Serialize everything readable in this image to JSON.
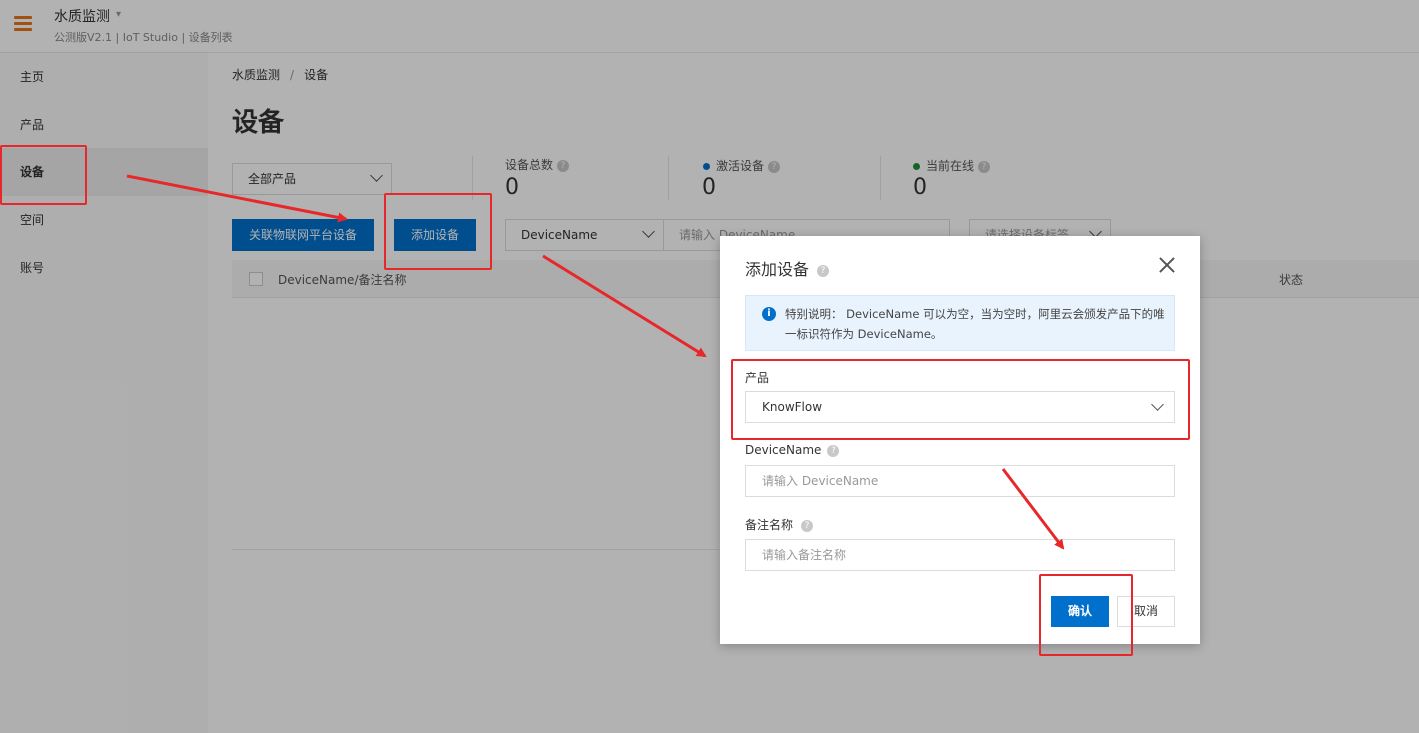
{
  "header": {
    "app_title": "水质监测",
    "caret": "▾",
    "subtitle": "公测版V2.1 | IoT Studio | 设备列表"
  },
  "sidebar": {
    "items": [
      {
        "label": "主页"
      },
      {
        "label": "产品"
      },
      {
        "label": "设备",
        "active": true
      },
      {
        "label": "空间"
      },
      {
        "label": "账号"
      }
    ]
  },
  "breadcrumb": {
    "root": "水质监测",
    "sep": "/",
    "current": "设备"
  },
  "page_title": "设备",
  "filters": {
    "product_select": "全部产品",
    "name_select": "DeviceName",
    "search_placeholder": "请输入 DeviceName",
    "tag_select_placeholder": "请选择设备标签"
  },
  "stats": {
    "total": {
      "label": "设备总数",
      "value": "0"
    },
    "activated": {
      "label": "激活设备",
      "value": "0",
      "color": "#0070cc"
    },
    "online": {
      "label": "当前在线",
      "value": "0",
      "color": "#1e8e3e"
    }
  },
  "buttons": {
    "link_platform": "关联物联网平台设备",
    "add_device": "添加设备"
  },
  "table": {
    "columns": [
      "DeviceName/备注名称",
      "状态"
    ]
  },
  "dialog": {
    "title": "添加设备",
    "notice": "特别说明： DeviceName 可以为空，当为空时，阿里云会颁发产品下的唯一标识符作为 DeviceName。",
    "product_label": "产品",
    "product_value": "KnowFlow",
    "devicename_label": "DeviceName",
    "devicename_placeholder": "请输入 DeviceName",
    "remark_label": "备注名称",
    "remark_placeholder": "请输入备注名称",
    "ok": "确认",
    "cancel": "取消"
  },
  "annotation_color": "#e6282b"
}
